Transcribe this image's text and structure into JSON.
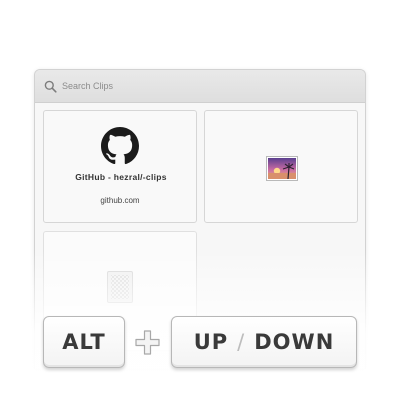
{
  "search": {
    "placeholder": "Search Clips"
  },
  "clips": [
    {
      "type": "link",
      "title": "GitHub - hezral/-clips",
      "source": "github.com",
      "icon": "github-icon"
    },
    {
      "type": "image",
      "icon": "image-thumbnail-icon"
    },
    {
      "type": "file",
      "icon": "file-icon"
    }
  ],
  "shortcut": {
    "modifier": "ALT",
    "plus_icon": "plus-icon",
    "key_up": "UP",
    "separator": "/",
    "key_down": "DOWN"
  },
  "colors": {
    "key_text": "#3a3a3a",
    "panel_bg": "#f7f7f7",
    "search_bar_bg": "#e4e4e4"
  }
}
